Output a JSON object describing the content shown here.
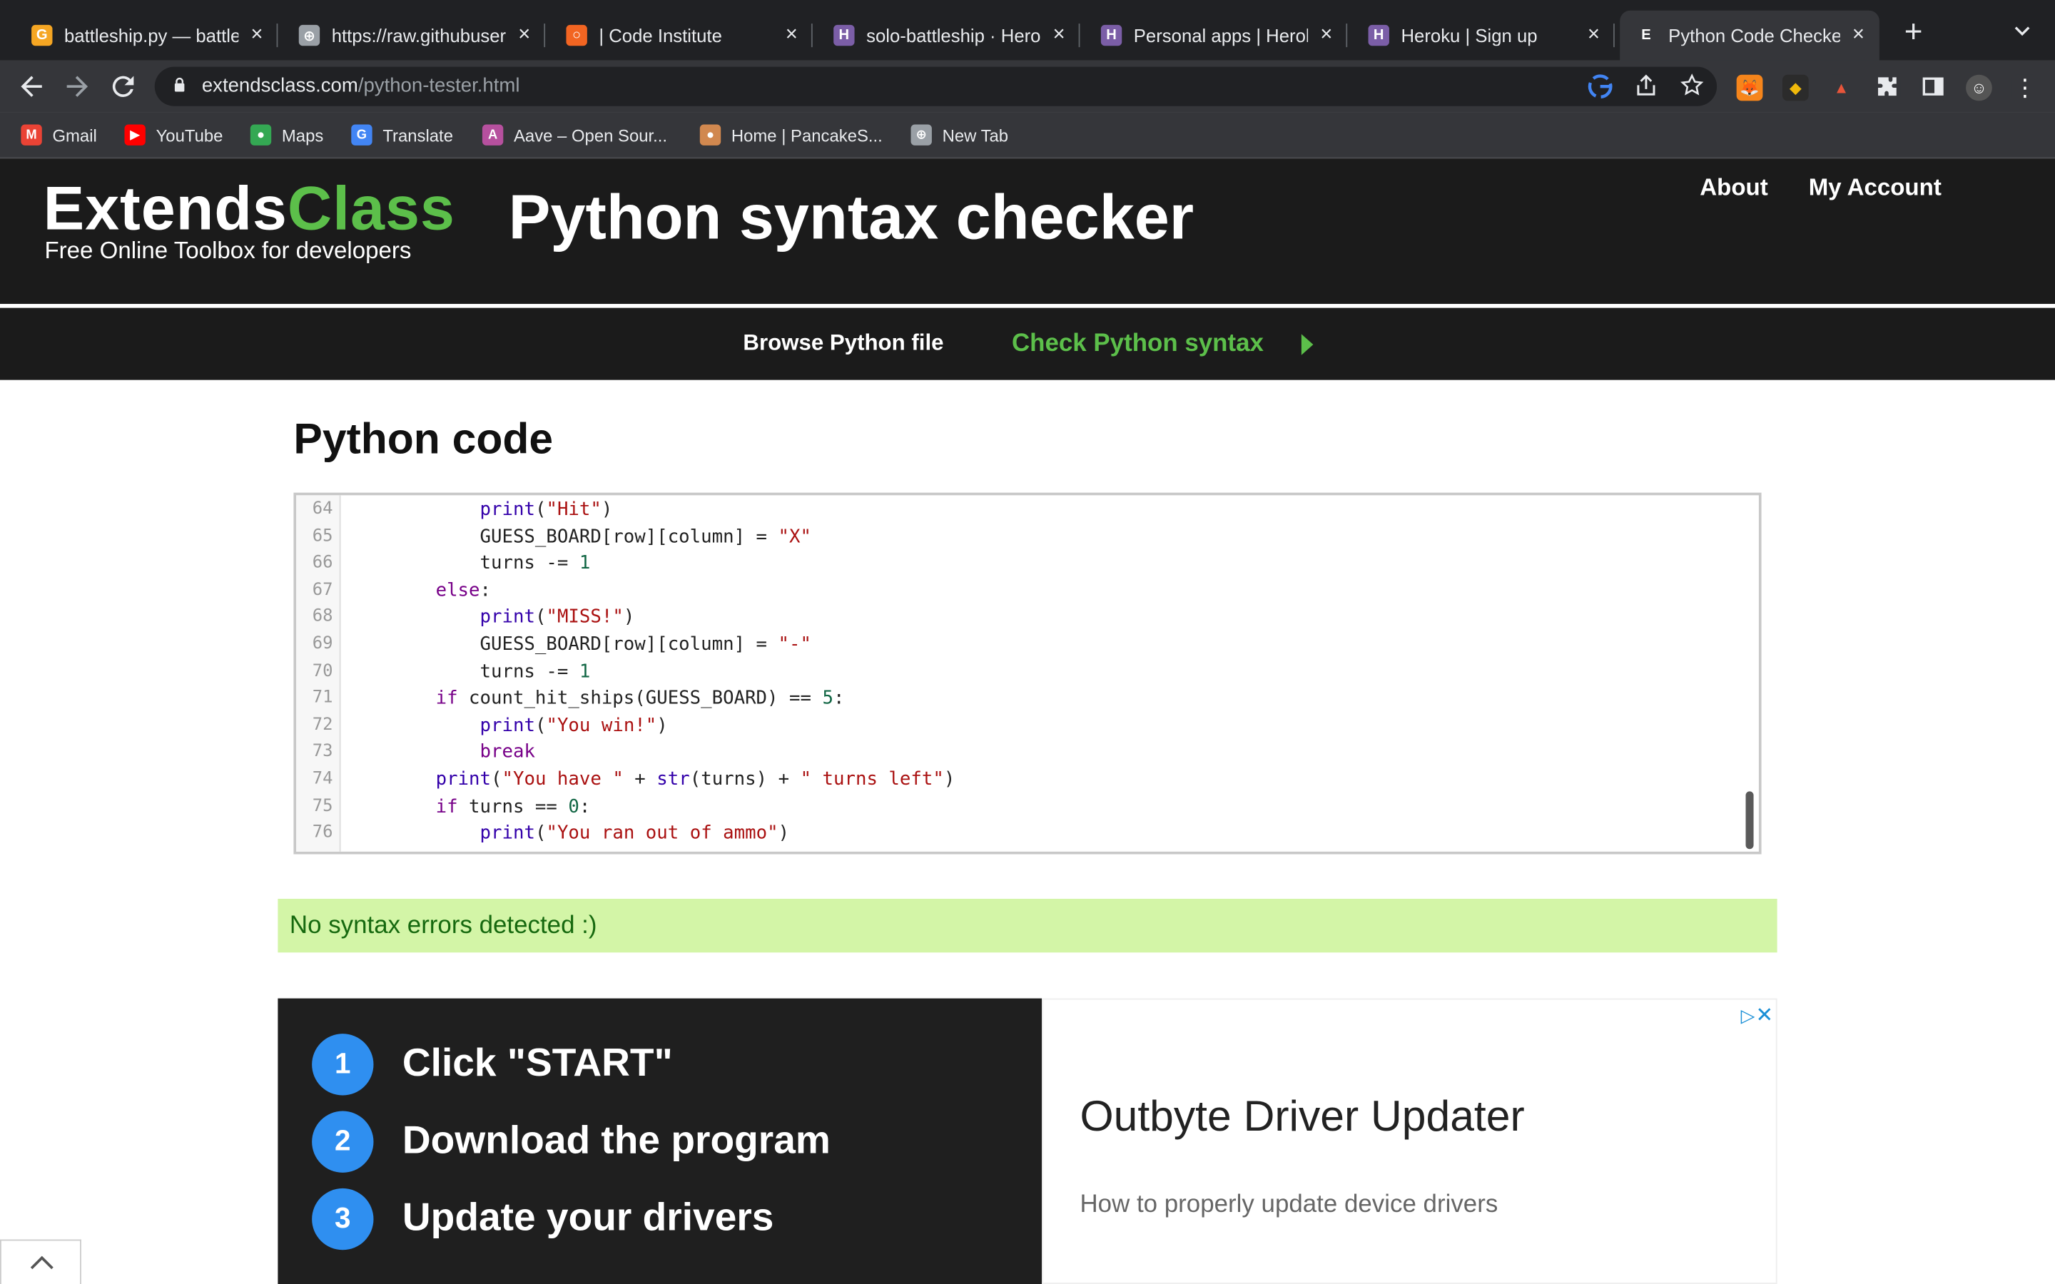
{
  "browser": {
    "tabs": [
      {
        "label": "battleship.py — battle",
        "favicon_color": "#f5a623",
        "favicon_char": "G"
      },
      {
        "label": "https://raw.githubuser",
        "favicon_color": "#9aa0a6",
        "favicon_char": "⊕"
      },
      {
        "label": "| Code Institute",
        "favicon_color": "#f26522",
        "favicon_char": "○"
      },
      {
        "label": "solo-battleship · Hero",
        "favicon_color": "#7b5ea7",
        "favicon_char": "H"
      },
      {
        "label": "Personal apps | Herok",
        "favicon_color": "#7b5ea7",
        "favicon_char": "H"
      },
      {
        "label": "Heroku | Sign up",
        "favicon_color": "#7b5ea7",
        "favicon_char": "H"
      },
      {
        "label": "Python Code Checker",
        "favicon_color": "#35363a",
        "favicon_char": "E",
        "active": true
      }
    ],
    "new_tab": "+",
    "url_host": "extendsclass.com",
    "url_path": "/python-tester.html",
    "bookmarks": [
      {
        "label": "Gmail",
        "icon": "gmail-icon",
        "color": "#ea4335",
        "char": "M"
      },
      {
        "label": "YouTube",
        "icon": "youtube-icon",
        "color": "#ff0000",
        "char": "▶"
      },
      {
        "label": "Maps",
        "icon": "maps-icon",
        "color": "#34a853",
        "char": "●"
      },
      {
        "label": "Translate",
        "icon": "translate-icon",
        "color": "#4285f4",
        "char": "G"
      },
      {
        "label": "Aave – Open Sour...",
        "icon": "aave-icon",
        "color": "#b6509e",
        "char": "A"
      },
      {
        "label": "Home | PancakeS...",
        "icon": "pancakeswap-icon",
        "color": "#d1884f",
        "char": "●"
      },
      {
        "label": "New Tab",
        "icon": "globe-icon",
        "color": "#9aa0a6",
        "char": "⊕"
      }
    ]
  },
  "site": {
    "logo_main": "Extends",
    "logo_accent": "Class",
    "tagline": "Free Online Toolbox for developers",
    "title": "Python syntax checker",
    "about": "About",
    "account": "My Account",
    "browse": "Browse Python file",
    "check": "Check Python syntax"
  },
  "main": {
    "section_title": "Python code",
    "code_lines": [
      {
        "n": "64",
        "html": "            <span class=\"bi\">print</span>(<span class=\"str\">\"Hit\"</span>)"
      },
      {
        "n": "65",
        "html": "            GUESS_BOARD[row][column] = <span class=\"str\">\"X\"</span>"
      },
      {
        "n": "66",
        "html": "            turns -= <span class=\"num\">1</span>"
      },
      {
        "n": "67",
        "html": "        <span class=\"kw\">else</span>:"
      },
      {
        "n": "68",
        "html": "            <span class=\"bi\">print</span>(<span class=\"str\">\"MISS!\"</span>)"
      },
      {
        "n": "69",
        "html": "            GUESS_BOARD[row][column] = <span class=\"str\">\"-\"</span>"
      },
      {
        "n": "70",
        "html": "            turns -= <span class=\"num\">1</span>"
      },
      {
        "n": "71",
        "html": "        <span class=\"kw\">if</span> count_hit_ships(GUESS_BOARD) == <span class=\"num\">5</span>:"
      },
      {
        "n": "72",
        "html": "            <span class=\"bi\">print</span>(<span class=\"str\">\"You win!\"</span>)"
      },
      {
        "n": "73",
        "html": "            <span class=\"kw\">break</span>"
      },
      {
        "n": "74",
        "html": "        <span class=\"bi\">print</span>(<span class=\"str\">\"You have \"</span> + <span class=\"bi\">str</span>(turns) + <span class=\"str\">\" turns left\"</span>)"
      },
      {
        "n": "75",
        "html": "        <span class=\"kw\">if</span> turns == <span class=\"num\">0</span>:"
      },
      {
        "n": "76",
        "html": "            <span class=\"bi\">print</span>(<span class=\"str\">\"You ran out of ammo\"</span>)"
      }
    ],
    "result": "No syntax errors detected :)"
  },
  "ad": {
    "steps": [
      {
        "num": "1",
        "text": "Click \"START\""
      },
      {
        "num": "2",
        "text": "Download the program"
      },
      {
        "num": "3",
        "text": "Update your drivers"
      }
    ],
    "title": "Outbyte Driver Updater",
    "description": "How to properly update device drivers"
  },
  "colors": {
    "brand_green": "#5cbf4a",
    "header_bg": "#1b1b1b",
    "success_bg": "#d3f5a7",
    "ad_blue": "#2f8ff0"
  }
}
